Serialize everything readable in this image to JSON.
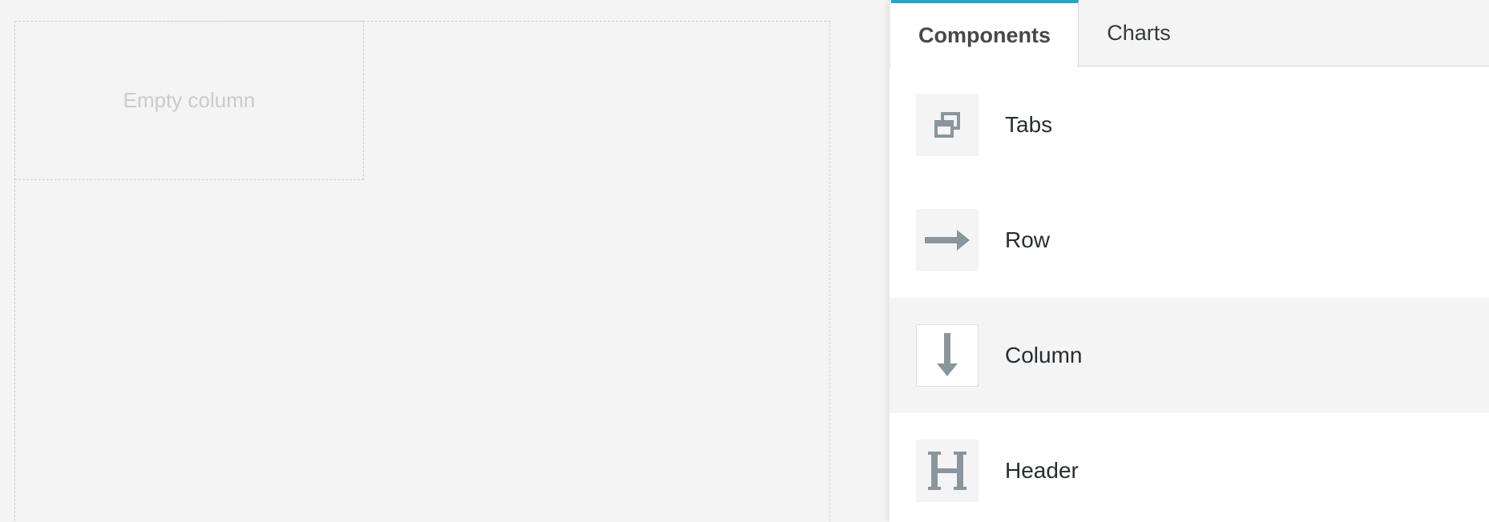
{
  "canvas": {
    "empty_column_label": "Empty column"
  },
  "panel": {
    "tabs": [
      {
        "label": "Components",
        "active": true
      },
      {
        "label": "Charts",
        "active": false
      }
    ],
    "accent_color": "#1fa8c9",
    "items": [
      {
        "label": "Tabs",
        "icon": "tabs-icon"
      },
      {
        "label": "Row",
        "icon": "arrow-right-icon"
      },
      {
        "label": "Column",
        "icon": "arrow-down-icon",
        "highlighted": true
      },
      {
        "label": "Header",
        "icon": "header-icon"
      }
    ]
  }
}
